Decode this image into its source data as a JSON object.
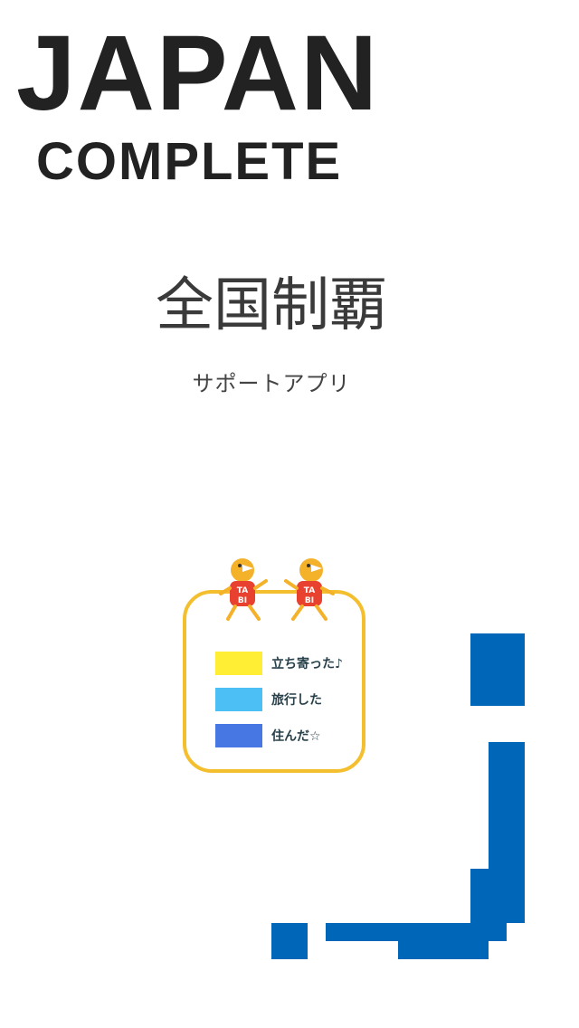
{
  "header": {
    "title": "JAPAN",
    "subtitle": "COMPLETE"
  },
  "main": {
    "heading": "全国制覇",
    "subheading": "サポートアプリ"
  },
  "legend": {
    "mascot_text_top": "TA",
    "mascot_text_bottom": "BI",
    "items": [
      {
        "label": "立ち寄った♪",
        "color": "#ffee33"
      },
      {
        "label": "旅行した",
        "color": "#4cbff5"
      },
      {
        "label": "住んだ☆",
        "color": "#4677e3"
      }
    ]
  },
  "colors": {
    "accent": "#f4bf2f",
    "map": "#0066b8",
    "mascot_head": "#f4b12a",
    "mascot_body": "#e8412f",
    "text_dark": "#222222"
  }
}
